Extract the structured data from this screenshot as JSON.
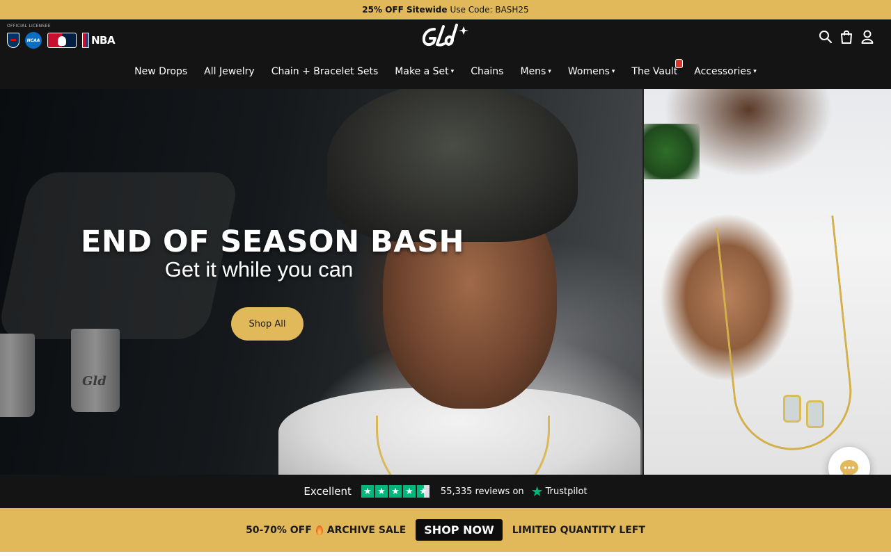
{
  "promo": {
    "bold": "25% OFF Sitewide",
    "text": "Use Code: BASH25"
  },
  "header": {
    "licensee_label": "OFFICIAL LICENSEE",
    "leagues": {
      "ncaa": "NCAA",
      "nba": "NBA"
    },
    "logo_text": "GLD",
    "icons": [
      "search-icon",
      "bag-icon",
      "user-icon"
    ]
  },
  "nav": {
    "items": [
      {
        "label": "New Drops",
        "dropdown": false
      },
      {
        "label": "All Jewelry",
        "dropdown": false
      },
      {
        "label": "Chain + Bracelet Sets",
        "dropdown": false
      },
      {
        "label": "Make a Set",
        "dropdown": true
      },
      {
        "label": "Chains",
        "dropdown": false
      },
      {
        "label": "Mens",
        "dropdown": true
      },
      {
        "label": "Womens",
        "dropdown": true
      },
      {
        "label": "The Vault",
        "dropdown": false
      },
      {
        "label": "Accessories",
        "dropdown": true
      }
    ],
    "caret": "▾"
  },
  "hero": {
    "title": "END OF SEASON BASH",
    "subtitle": "Get it while you can",
    "cta": "Shop All",
    "cup_logo": "Gld"
  },
  "trustpilot": {
    "rating_word": "Excellent",
    "stars": 4.5,
    "reviews_text": "55,335 reviews on",
    "brand": "Trustpilot"
  },
  "sale_banner": {
    "left_text": "50-70% OFF",
    "sale_name": "ARCHIVE SALE",
    "cta": "SHOP NOW",
    "right_text": "LIMITED QUANTITY LEFT"
  },
  "colors": {
    "accent_gold": "#e1b95b",
    "header_bg": "#141414",
    "trustpilot_green": "#00b67a"
  }
}
